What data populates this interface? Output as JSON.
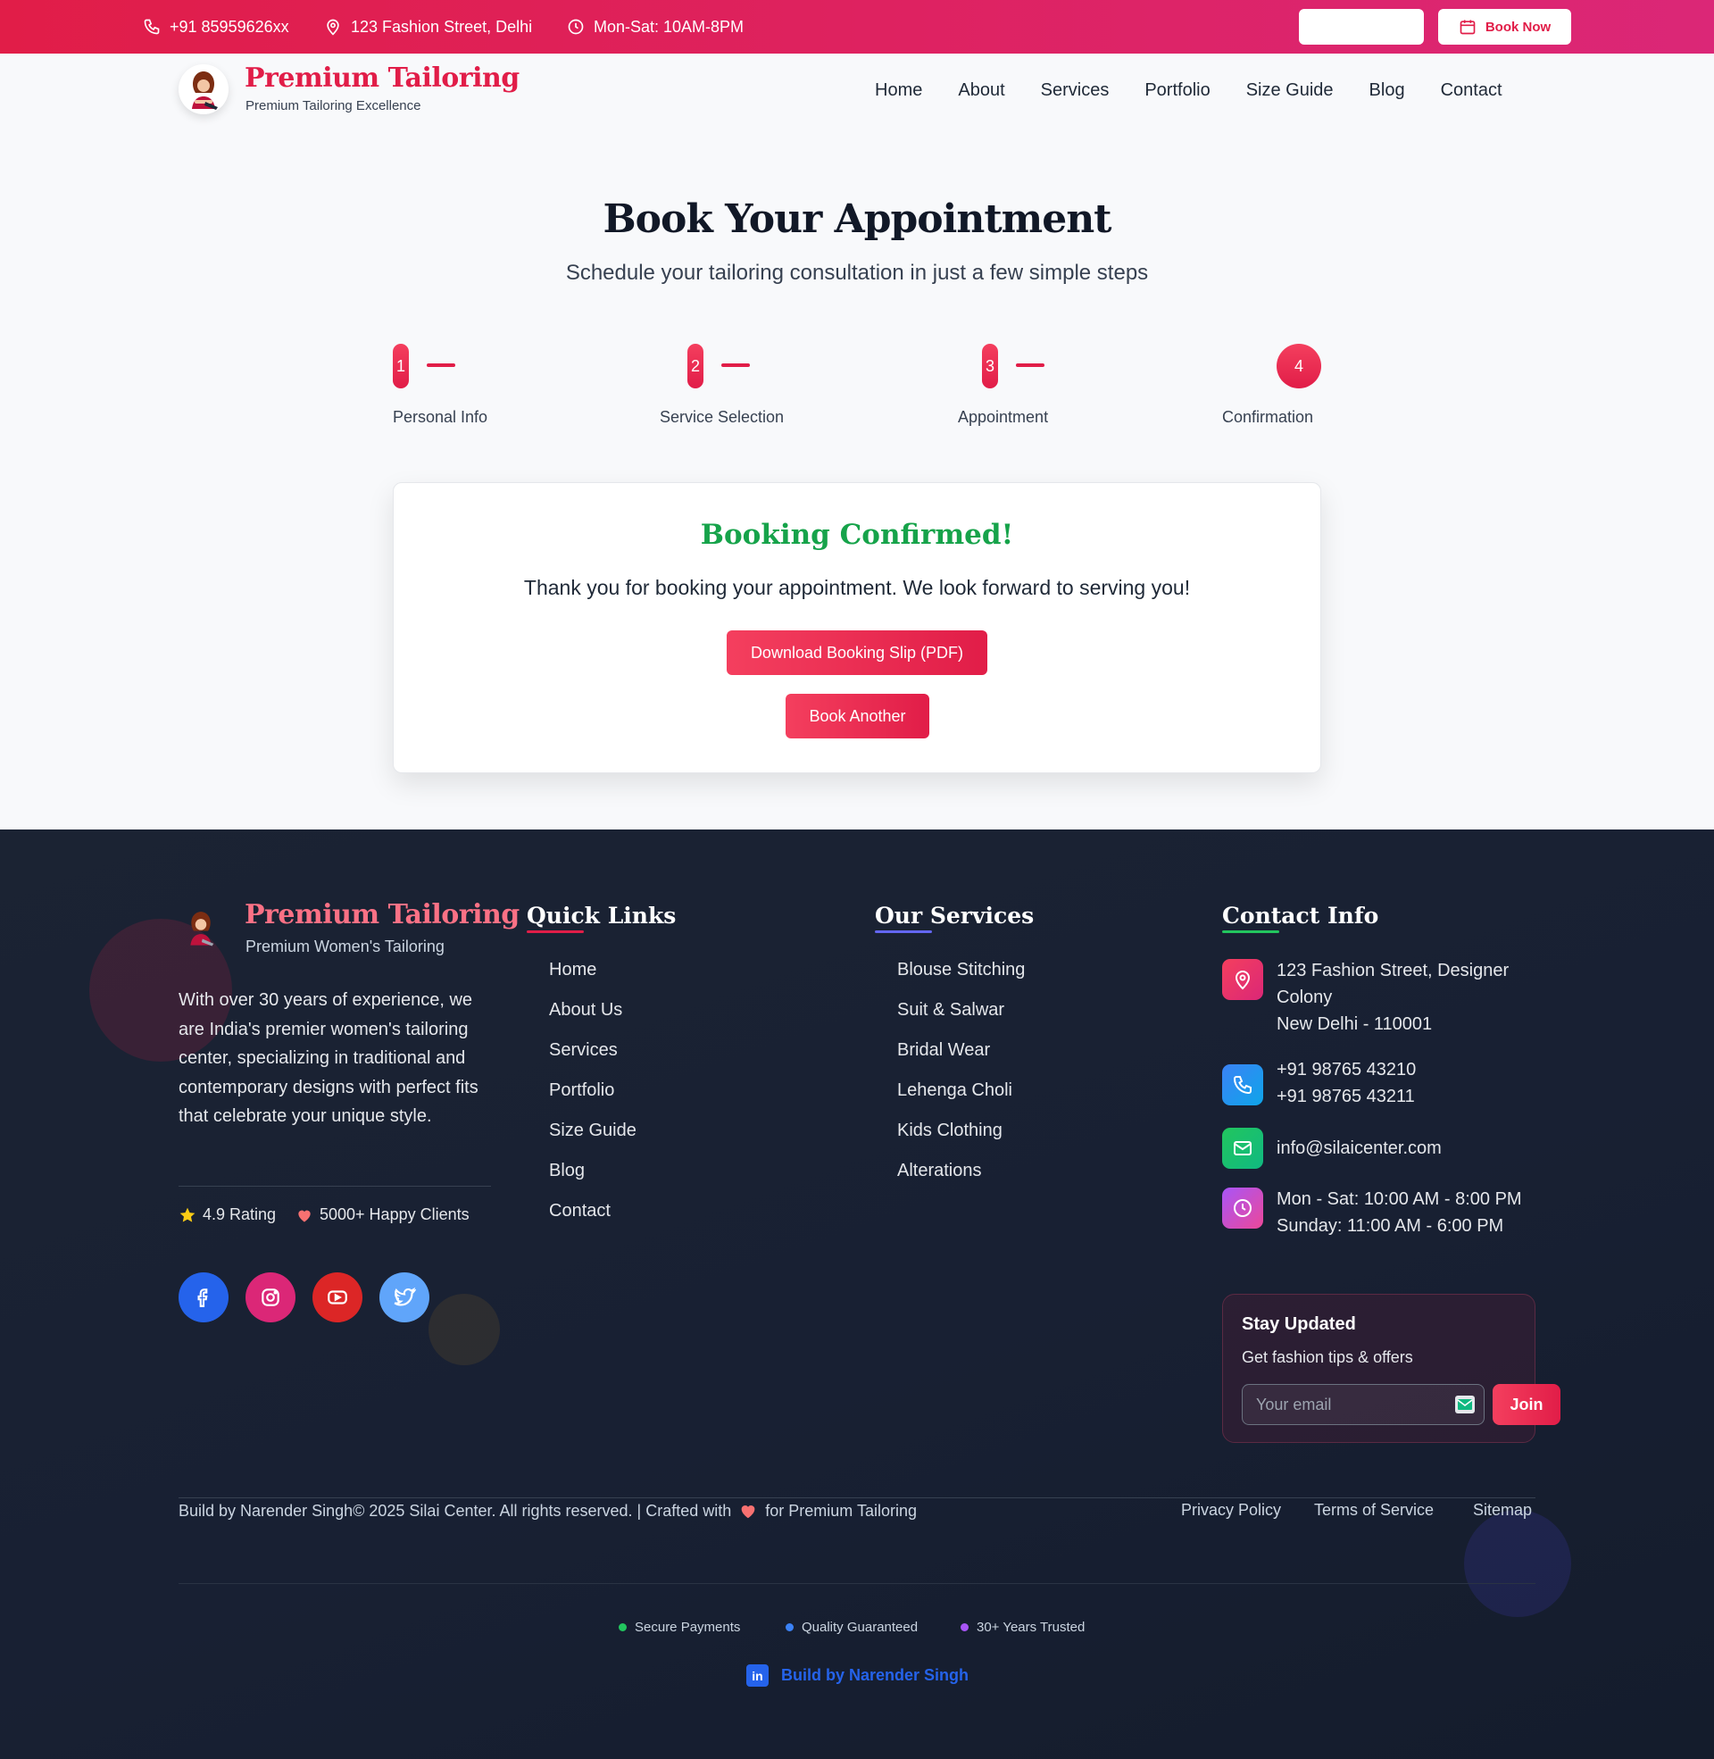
{
  "topbar": {
    "phone": "+91 85959626xx",
    "address": "123 Fashion Street, Delhi",
    "hours": "Mon-Sat: 10AM-8PM",
    "book_label": "Book Now"
  },
  "brand": {
    "name": "Premium Tailoring",
    "tagline": "Premium Tailoring Excellence",
    "footer_tagline": "Premium Women's Tailoring"
  },
  "nav": {
    "items": [
      "Home",
      "About",
      "Services",
      "Portfolio",
      "Size Guide",
      "Blog",
      "Contact"
    ]
  },
  "hero": {
    "title": "Book Your Appointment",
    "subtitle": "Schedule your tailoring consultation in just a few simple steps"
  },
  "steps": [
    {
      "num": "1",
      "label": "Personal Info"
    },
    {
      "num": "2",
      "label": "Service Selection"
    },
    {
      "num": "3",
      "label": "Appointment"
    },
    {
      "num": "4",
      "label": "Confirmation"
    }
  ],
  "confirmation": {
    "title": "Booking Confirmed!",
    "message": "Thank you for booking your appointment. We look forward to serving you!",
    "download_label": "Download Booking Slip (PDF)",
    "book_another_label": "Book Another"
  },
  "footer": {
    "about": "With over 30 years of experience, we are India's premier women's tailoring center, specializing in traditional and contemporary designs with perfect fits that celebrate your unique style.",
    "rating": "4.9 Rating",
    "clients": "5000+ Happy Clients",
    "social": [
      "facebook-icon",
      "instagram-icon",
      "youtube-icon",
      "twitter-icon"
    ],
    "quick_links": {
      "title": "Quick Links",
      "items": [
        "Home",
        "About Us",
        "Services",
        "Portfolio",
        "Size Guide",
        "Blog",
        "Contact"
      ]
    },
    "services": {
      "title": "Our Services",
      "items": [
        "Blouse Stitching",
        "Suit & Salwar",
        "Bridal Wear",
        "Lehenga Choli",
        "Kids Clothing",
        "Alterations"
      ]
    },
    "contact": {
      "title": "Contact Info",
      "address_line1": "123 Fashion Street, Designer Colony",
      "address_line2": "New Delhi - 110001",
      "phone1": "+91 98765 43210",
      "phone2": "+91 98765 43211",
      "email": "info@silaicenter.com",
      "hours_line1": "Mon - Sat: 10:00 AM - 8:00 PM",
      "hours_line2": "Sunday: 11:00 AM - 6:00 PM"
    },
    "newsletter": {
      "title": "Stay Updated",
      "subtitle": "Get fashion tips & offers",
      "placeholder": "Your email",
      "join_label": "Join"
    },
    "copyright_pre": "Build by Narender Singh© 2025 Silai Center. All rights reserved. | Crafted with",
    "copyright_post": "for Premium Tailoring",
    "legal": [
      "Privacy Policy",
      "Terms of Service",
      "Sitemap"
    ],
    "trust": [
      {
        "label": "Secure Payments",
        "color": "#22c55e"
      },
      {
        "label": "Quality Guaranteed",
        "color": "#3b82f6"
      },
      {
        "label": "30+ Years Trusted",
        "color": "#a855f7"
      }
    ],
    "built_by": "Build by Narender Singh"
  },
  "colors": {
    "brand": "#e11d48",
    "success": "#16a34a",
    "footer_bg": "#1b2333"
  }
}
